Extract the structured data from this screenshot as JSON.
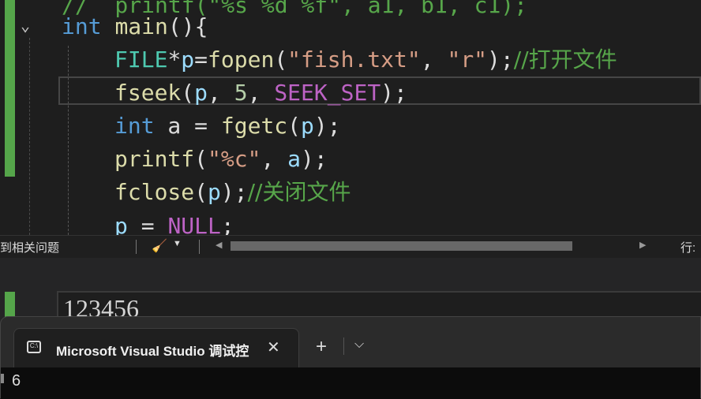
{
  "editor": {
    "line_int": [
      "int",
      " ",
      "main",
      "(){"
    ],
    "line_fopen": [
      "FILE",
      "*",
      "p",
      "=",
      "fopen",
      "(",
      "\"fish.txt\"",
      ", ",
      "\"r\"",
      ");",
      "//打开文件"
    ],
    "line_fseek": [
      "fseek",
      "(",
      "p",
      ", ",
      "5",
      ", ",
      "SEEK_SET",
      ");"
    ],
    "line_fgetc": [
      "int",
      " a = ",
      "fgetc",
      "(",
      "p",
      ");"
    ],
    "line_printf": [
      "printf",
      "(",
      "\"%c\"",
      ", ",
      "a",
      ");"
    ],
    "line_fclose": [
      "fclose",
      "(",
      "p",
      ");",
      "//关闭文件"
    ],
    "line_null": [
      "p",
      " = ",
      "NULL",
      ";"
    ]
  },
  "statusbar": {
    "issues_label": "到相关问题",
    "row_label": "行:"
  },
  "output": {
    "text": "123456"
  },
  "terminal": {
    "tab_title": "Microsoft Visual Studio 调试控",
    "close_glyph": "✕",
    "plus_glyph": "+",
    "chevron_glyph": "⌵",
    "output_text": "6"
  },
  "colors": {
    "keyword": "#569cd6",
    "function": "#dcdcaa",
    "string": "#d69d85",
    "comment": "#57a64a",
    "variable": "#9cdcfe",
    "macro": "#bd63c5",
    "green_bar": "#55a54a"
  }
}
